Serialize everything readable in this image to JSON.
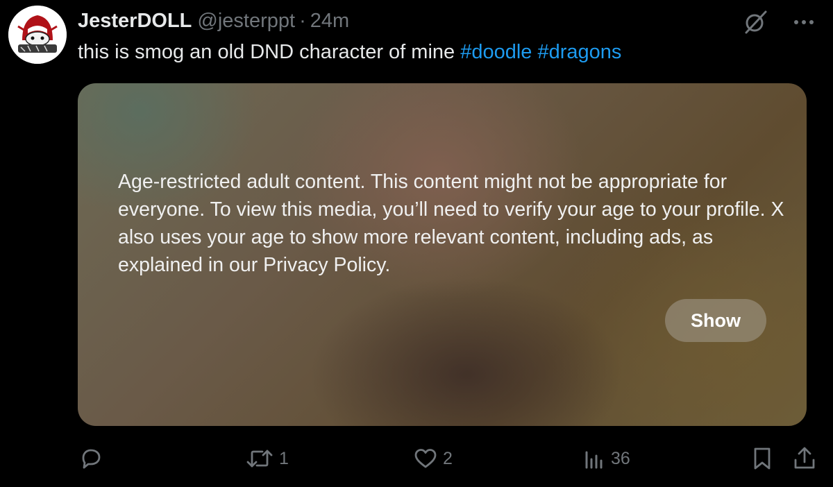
{
  "user": {
    "display_name": "JesterDOLL",
    "handle": "@jesterppt",
    "separator": "·",
    "time": "24m"
  },
  "post": {
    "text": "this is smog an old DND character of mine",
    "hashtags": [
      "#doodle",
      "#dragons"
    ]
  },
  "media": {
    "warning": "Age-restricted adult content. This content might not be appropriate for everyone. To view this media, you’ll need to verify your age to your profile. X also uses your age to show more relevant content, including ads, as explained in our Privacy Policy.",
    "show_label": "Show"
  },
  "actions": {
    "reply_count": "",
    "repost_count": "1",
    "like_count": "2",
    "views_count": "36"
  },
  "icons": {
    "top": [
      "grok-icon",
      "more-icon"
    ],
    "actions": [
      "reply-icon",
      "repost-icon",
      "like-icon",
      "views-icon",
      "bookmark-icon",
      "share-icon"
    ]
  },
  "colors": {
    "background": "#000000",
    "text": "#e7e9ea",
    "secondary": "#71767b",
    "accent": "#1d9bf0"
  }
}
